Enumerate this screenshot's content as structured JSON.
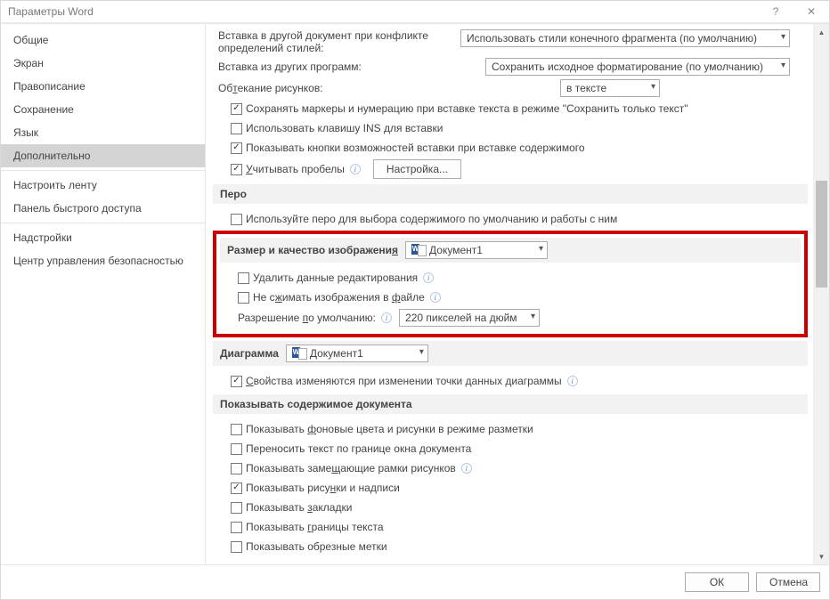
{
  "titlebar": {
    "title": "Параметры Word"
  },
  "sidebar": {
    "items": [
      {
        "label": "Общие"
      },
      {
        "label": "Экран"
      },
      {
        "label": "Правописание"
      },
      {
        "label": "Сохранение"
      },
      {
        "label": "Язык"
      },
      {
        "label": "Дополнительно"
      },
      {
        "label": "Настроить ленту"
      },
      {
        "label": "Панель быстрого доступа"
      },
      {
        "label": "Надстройки"
      },
      {
        "label": "Центр управления безопасностью"
      }
    ],
    "active_index": 5
  },
  "main": {
    "partial_top_label_a": "Вставка в другой документ при конфликте",
    "partial_top_label_b": "определений стилей:",
    "partial_top_select": "Использовать стили конечного фрагмента (по умолчанию)",
    "insert_other_label": "Вставка из других программ:",
    "insert_other_select": "Сохранить исходное форматирование (по умолчанию)",
    "wrap_images_label": "Обтекание рисунков:",
    "wrap_images_select": "в тексте",
    "keep_bullets": "Сохранять маркеры и нумерацию при вставке текста в режиме \"Сохранить только текст\"",
    "use_ins_key": "Использовать клавишу INS для вставки",
    "show_paste_options": "Показывать кнопки возможностей вставки при вставке содержимого",
    "smart_cut_paste": "Учитывать пробелы",
    "settings_btn": "Настройка...",
    "pen_section": "Перо",
    "pen_option": "Используйте перо для выбора содержимого по умолчанию и работы с ним",
    "image_section": "Размер и качество изображения",
    "image_doc": "Документ1",
    "discard_edit": "Удалить данные редактирования",
    "no_compress": "Не сжимать изображения в файле",
    "default_res_label": "Разрешение по умолчанию:",
    "default_res_select": "220 пикселей на дюйм",
    "chart_section": "Диаграмма",
    "chart_doc": "Документ1",
    "chart_option": "Свойства изменяются при изменении точки данных диаграммы",
    "show_content_section": "Показывать содержимое документа",
    "show_bg": "Показывать фоновые цвета и рисунки в режиме разметки",
    "wrap_text": "Переносить текст по границе окна документа",
    "placeholder_frames": "Показывать замещающие рамки рисунков",
    "show_drawings": "Показывать рисунки и надписи",
    "show_bookmarks": "Показывать закладки",
    "show_text_borders": "Показывать границы текста",
    "show_crop_marks": "Показывать обрезные метки"
  },
  "footer": {
    "ok": "ОК",
    "cancel": "Отмена"
  }
}
